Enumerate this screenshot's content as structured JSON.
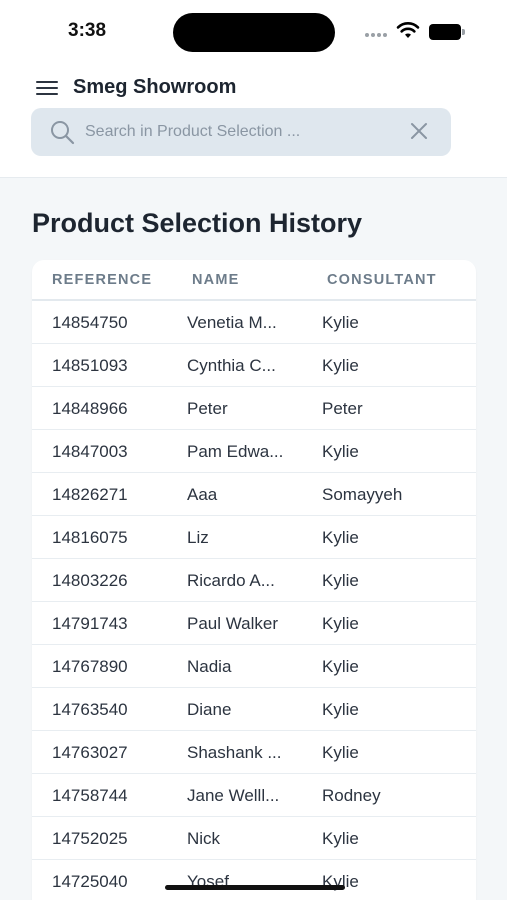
{
  "status_bar": {
    "time": "3:38"
  },
  "header": {
    "title": "Smeg Showroom"
  },
  "search": {
    "placeholder": "Search in Product Selection ..."
  },
  "page": {
    "title": "Product Selection History"
  },
  "table": {
    "columns": [
      "REFERENCE",
      "NAME",
      "CONSULTANT"
    ],
    "rows": [
      {
        "reference": "14854750",
        "name": "Venetia M...",
        "consultant": "Kylie"
      },
      {
        "reference": "14851093",
        "name": "Cynthia C...",
        "consultant": "Kylie"
      },
      {
        "reference": "14848966",
        "name": "Peter",
        "consultant": "Peter"
      },
      {
        "reference": "14847003",
        "name": "Pam Edwa...",
        "consultant": "Kylie"
      },
      {
        "reference": "14826271",
        "name": "Aaa",
        "consultant": "Somayyeh"
      },
      {
        "reference": "14816075",
        "name": "Liz",
        "consultant": "Kylie"
      },
      {
        "reference": "14803226",
        "name": "Ricardo A...",
        "consultant": "Kylie"
      },
      {
        "reference": "14791743",
        "name": "Paul Walker",
        "consultant": "Kylie"
      },
      {
        "reference": "14767890",
        "name": "Nadia",
        "consultant": "Kylie"
      },
      {
        "reference": "14763540",
        "name": "Diane",
        "consultant": "Kylie"
      },
      {
        "reference": "14763027",
        "name": "Shashank ...",
        "consultant": "Kylie"
      },
      {
        "reference": "14758744",
        "name": "Jane Welll...",
        "consultant": "Rodney"
      },
      {
        "reference": "14752025",
        "name": "Nick",
        "consultant": "Kylie"
      },
      {
        "reference": "14725040",
        "name": "Yosef",
        "consultant": "Kylie"
      }
    ]
  },
  "icons": {
    "menu": "hamburger-menu-icon",
    "search": "magnifier-icon",
    "clear": "close-x-icon",
    "wifi": "wifi-icon",
    "battery": "battery-icon",
    "signal": "cellular-signal-icon"
  }
}
